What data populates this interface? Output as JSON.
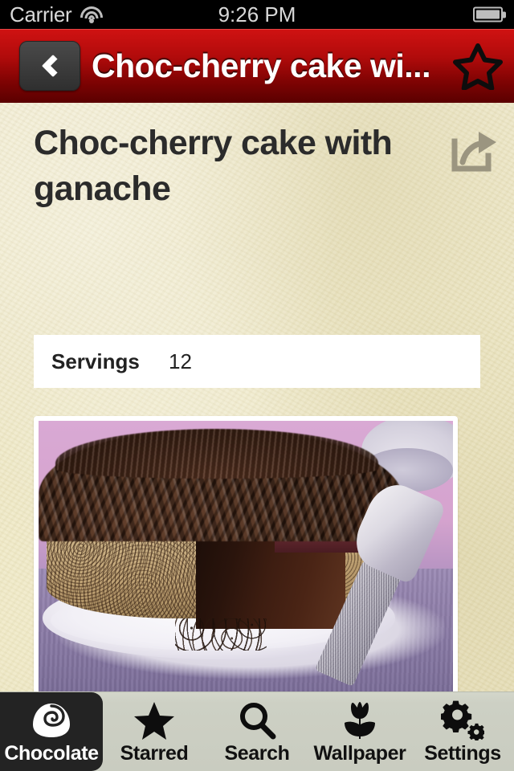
{
  "status_bar": {
    "carrier": "Carrier",
    "wifi_icon": "wifi-icon",
    "time": "9:26 PM",
    "battery_icon": "battery-icon"
  },
  "nav_bar": {
    "back_icon": "chevron-left-icon",
    "title": "Choc-cherry cake wi...",
    "favorite_icon": "star-outline-icon",
    "accent_color": "#b10b0b"
  },
  "recipe": {
    "title": "Choc-cherry cake with ganache",
    "share_icon": "share-export-icon",
    "info": {
      "label": "Servings",
      "value": "12"
    },
    "photo_alt": "choc-cherry-cake-photo"
  },
  "tab_bar": {
    "background_color": "#cdd0c4",
    "active_background": "#232323",
    "items": [
      {
        "label": "Chocolate",
        "icon": "chocolate-truffle-icon",
        "active": true
      },
      {
        "label": "Starred",
        "icon": "star-filled-icon",
        "active": false
      },
      {
        "label": "Search",
        "icon": "magnifier-icon",
        "active": false
      },
      {
        "label": "Wallpaper",
        "icon": "tulip-icon",
        "active": false
      },
      {
        "label": "Settings",
        "icon": "gears-icon",
        "active": false
      }
    ]
  }
}
